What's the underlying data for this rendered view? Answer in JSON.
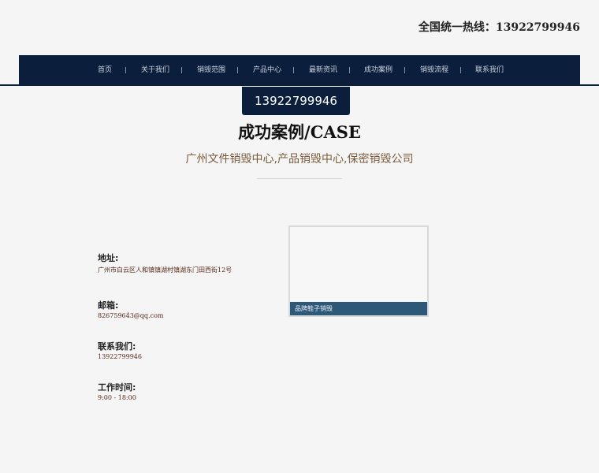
{
  "header": {
    "hotline": "全国统一热线：13922799946"
  },
  "nav": {
    "items": [
      {
        "label": "首页"
      },
      {
        "label": "关于我们"
      },
      {
        "label": "销毁范围"
      },
      {
        "label": "产品中心"
      },
      {
        "label": "最新资讯"
      },
      {
        "label": "成功案例"
      },
      {
        "label": "销毁流程"
      },
      {
        "label": "联系我们"
      }
    ]
  },
  "phone_box": {
    "number": "13922799946"
  },
  "page": {
    "title": "成功案例/CASE",
    "subtitle": "广州文件销毁中心,产品销毁中心,保密销毁公司"
  },
  "contact": {
    "address_label": "地址:",
    "address_value": "广州市白云区人和镇镇湖村镇湖东门田西街12号",
    "email_label": "邮箱:",
    "email_value": "826759643@qq.com",
    "phone_label": "联系我们:",
    "phone_value": "13922799946",
    "hours_label": "工作时间:",
    "hours_value": "9:00 - 18:00"
  },
  "cases": [
    {
      "caption": "品牌鞋子销毁"
    }
  ],
  "colors": {
    "nav_bg": "#0b1f3c",
    "caption_bg": "#2d5878",
    "subtitle": "#7a5b3a"
  }
}
